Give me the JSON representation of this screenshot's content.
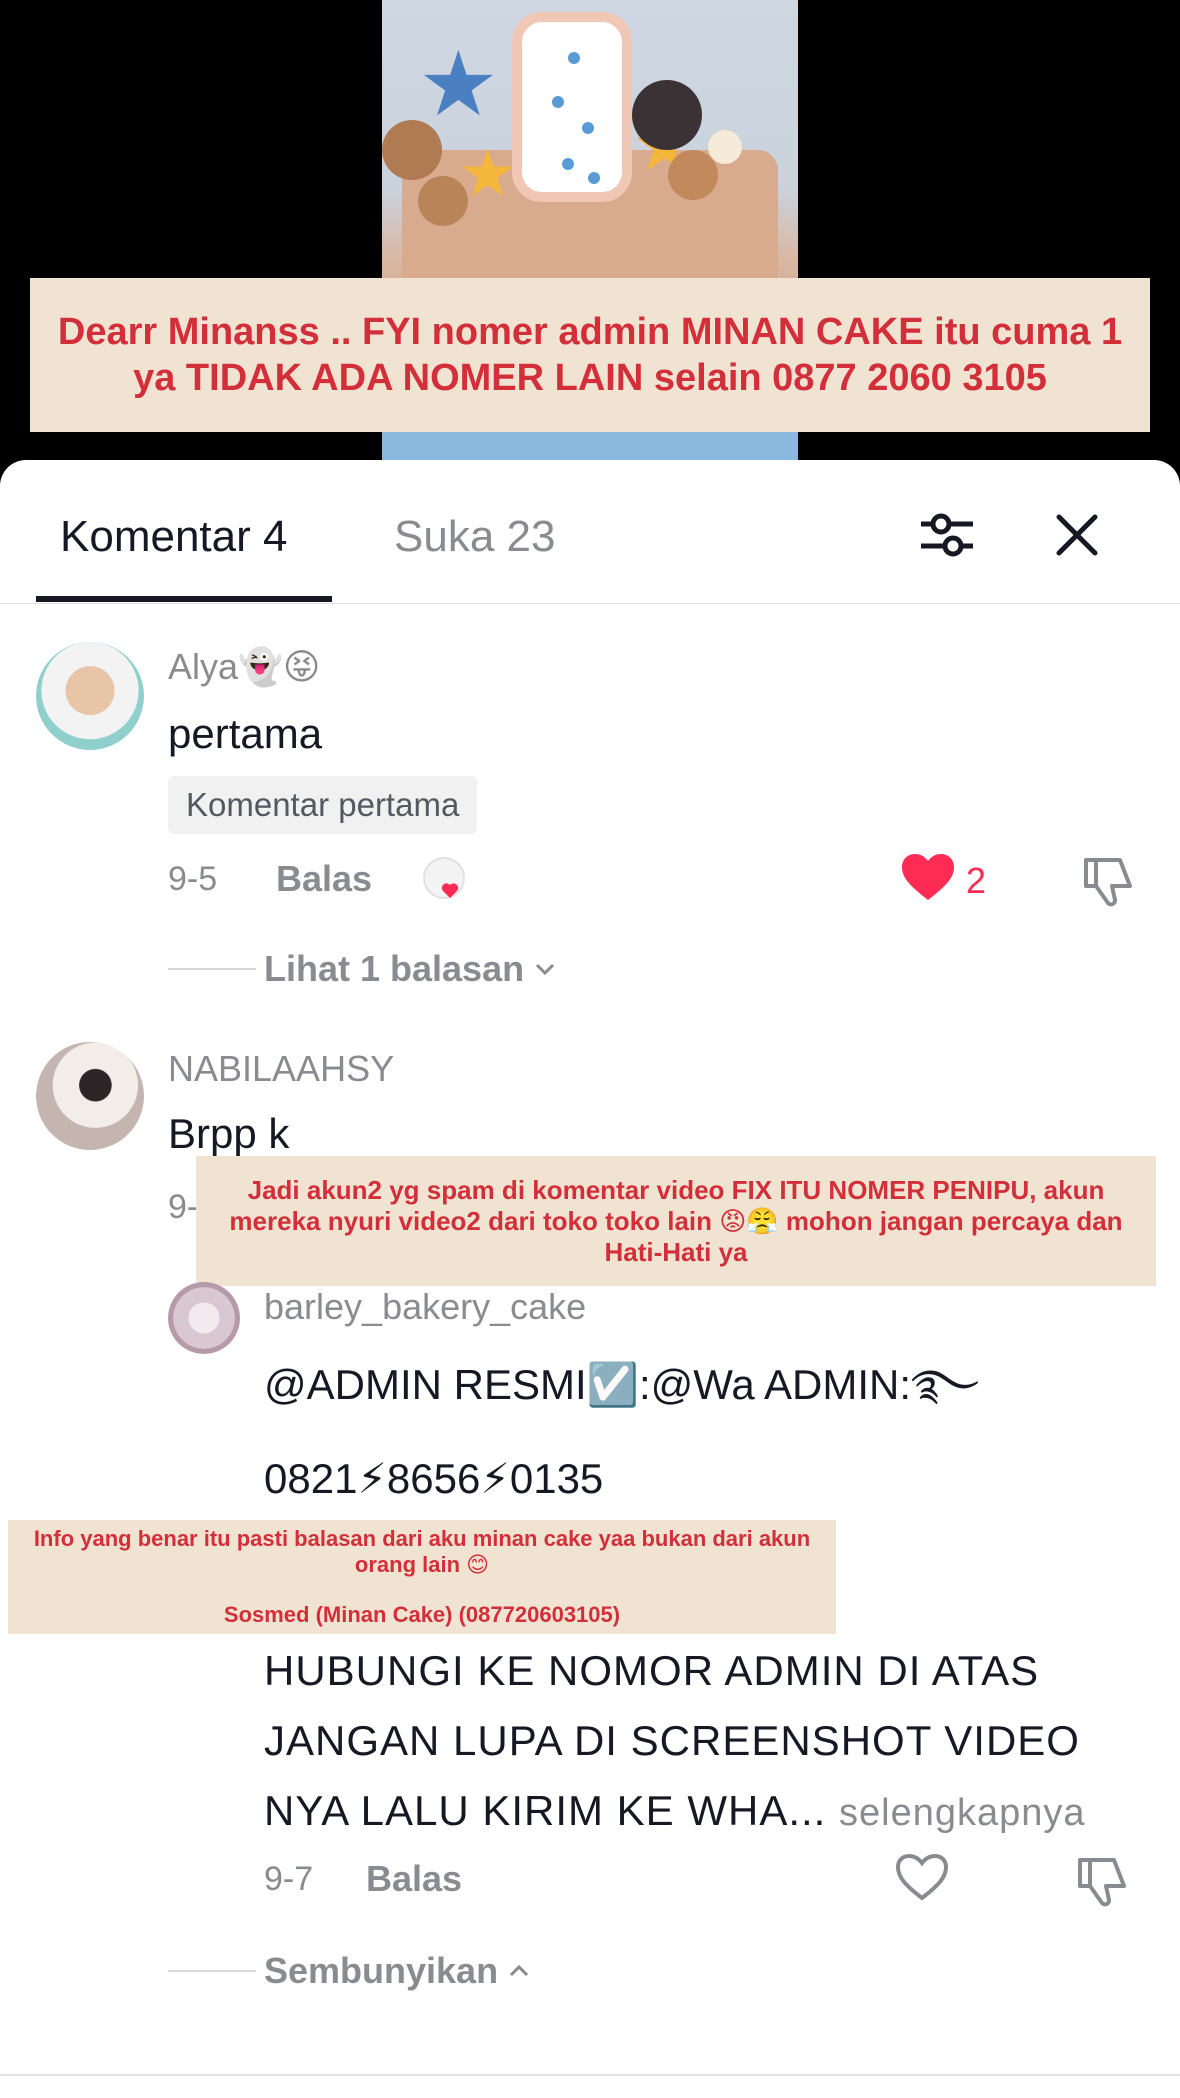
{
  "video": {
    "banner_text": "Dearr Minanss .. FYI nomer admin MINAN CAKE itu cuma 1 ya TIDAK ADA NOMER LAIN selain 0877 2060 3105"
  },
  "tabs": {
    "comments_label": "Komentar 4",
    "likes_label": "Suka 23"
  },
  "icons": {
    "filter": "sliders-icon",
    "close": "close-icon",
    "heart_filled": "heart-filled-icon",
    "heart_outline": "heart-outline-icon",
    "dislike": "dislike-icon",
    "chevron_down": "chevron-down-icon",
    "chevron_up": "chevron-up-icon"
  },
  "colors": {
    "accent_red": "#fe2c55",
    "banner_bg": "#f1e3d1",
    "banner_text": "#d32f3a"
  },
  "comments": [
    {
      "username": "Alya👻😝",
      "text": "pertama",
      "badge": "Komentar pertama",
      "date": "9-5",
      "reply_label": "Balas",
      "likes": "2",
      "view_replies": "Lihat 1 balasan"
    },
    {
      "username": "NABILAAHSY",
      "text": "Brpp k",
      "date": "9-",
      "reply": {
        "username": "barley_bakery_cake",
        "line1": "@ADMIN RESMI☑️:@Wa ADMIN:࿐",
        "line2": "0821⚡8656⚡0135",
        "line3": "HUBUNGI KE NOMOR ADMIN DI ATAS",
        "line4": "JANGAN LUPA DI SCREENSHOT VIDEO",
        "line5": "NYA LALU KIRIM KE WHA...",
        "more": "selengkapnya",
        "date": "9-7",
        "reply_label": "Balas"
      },
      "hide_label": "Sembunyikan"
    }
  ],
  "overlays": {
    "mid_banner": "Jadi akun2 yg spam di komentar video FIX ITU NOMER PENIPU, akun mereka nyuri video2 dari toko toko lain 😡😤 mohon jangan percaya dan Hati-Hati ya",
    "lower_banner_line1": "Info yang benar itu pasti balasan dari aku minan cake yaa bukan dari akun orang lain 😊",
    "lower_banner_line2": "Sosmed (Minan Cake) (087720603105)"
  }
}
